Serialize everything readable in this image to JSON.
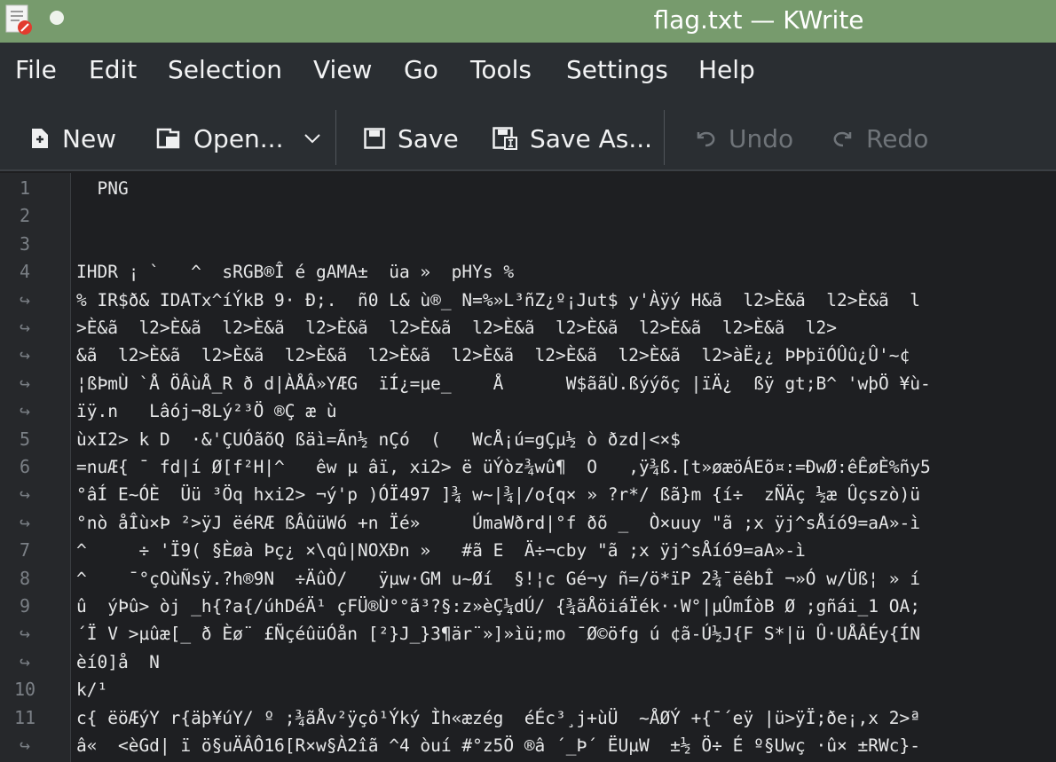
{
  "window": {
    "title": "flag.txt — KWrite"
  },
  "menubar": {
    "items": [
      "File",
      "Edit",
      "Selection",
      "View",
      "Go",
      "Tools",
      "Settings",
      "Help"
    ]
  },
  "toolbar": {
    "new_label": "New",
    "open_label": "Open...",
    "save_label": "Save",
    "save_as_label": "Save As...",
    "undo_label": "Undo",
    "redo_label": "Redo",
    "undo_enabled": false,
    "redo_enabled": false
  },
  "editor": {
    "gutter": [
      "1",
      "2",
      "3",
      "4",
      "↪",
      "↪",
      "↪",
      "↪",
      "↪",
      "5",
      "6",
      "↪",
      "↪",
      "7",
      "8",
      "9",
      "↪",
      "↪",
      "10",
      "11",
      "↪"
    ],
    "lines": [
      "  PNG",
      "",
      "",
      "IHDR ¡ `   ^  sRGB®Î é gAMA±  üa »  pHYs %",
      "% IR$ð& IDATx^íÝkB 9· Ð;.  ñ0 L& ù®_ N=%»L³ñZ¿º¡Jut$ y'Àÿý H&ã  l2>È&ã  l2>È&ã  l",
      ">È&ã  l2>È&ã  l2>È&ã  l2>È&ã  l2>È&ã  l2>È&ã  l2>È&ã  l2>È&ã  l2>È&ã  l2>",
      "&ã  l2>È&ã  l2>È&ã  l2>È&ã  l2>È&ã  l2>È&ã  l2>È&ã  l2>È&ã  l2>àË¿¿ ÞÞþïÓÛû¿Û'~¢",
      "¦ßÞmÙ `Å ÖÂùÅ_R ð d|ÀÅÂ»YÆG  ïÍ¿=µe_    Å      W$ããÙ.ßýýõç |ïÄ¿  ßÿ gt;B^ 'wþÖ ¥ù-",
      "ïÿ.n   Lâój¬8Lý²³Ö ®Ç æ ù",
      "ùxI2> k D  ·&'ÇUÓãõQ ßäì=Ãn½ nÇó  (   WcÅ¡ú=gÇµ½ ò ðzd|<×$",
      "=nuÆ{ ¯ fd|í Ø[f²H|^   êw µ âï, xi2> ë üÝòz¾wû¶  O   ,ÿ¾ß.[t»øæöÁEõ¤:=ÐwØ:êÊøÈ%ñy5",
      "°âÍ E~ÓÈ  Üü ³Öq hxi2> ¬ý'p )ÓÏ497 ]¾ w~|¾|/o{q× » ?r*/ ßã}m {í÷  zÑÄç ½æ Ûçszò)ü",
      "°nò åÎù×Þ ²>ÿJ ëéRÆ ßÂûüWó +n Ïé»     ÚmaWðrd|°f ðõ _  Ò×uuy \"ã ;x ÿj^sÅíó9=aA»-ì",
      "^     ÷ 'Ï9( §Èøà Þç¿ ×\\qû|NOXÐn »   #ã E  Ä÷¬cby \"ã ;x ÿj^sÅíó9=aA»-ì",
      "^    ¯°çOùÑsÿ.?h®9N  ÷ÄûÒ/   ÿµw·GM u~Øí  §!¦c Gé¬y ñ=/ö*ïP 2¾¯ëêbÎ ¬»Ó w/Üß¦ » í",
      "û  ýÞû> òj _h{?a{/úhDéÄ¹ çFÜ®Ù°°ã³?§:z»èÇ¼dÚ/ {¾ãÅöiáÏék··W°|µÛmÍòB Ø ;gñái_1 OA;",
      "´Ï V >µûæ[_ ð Èø¨ £ÑçéûüÓån [²}J_}3¶är¨»]»ìü;mo ¯Ø©öfg ú ¢ã-Ú½J{F S*|ü Û·UÅÂÉy{ÍN",
      "èí0]å  N",
      "k/¹",
      "c{ ëöÆýY r{äþ¥úY/ º ;¾ãÅv²ÿçô¹Ýký Ìh«æzég  éÉc³¸j+ùÜ  ~ÅØÝ +{¯´eÿ |ü>ÿÏ;ðe¡,x 2>ª",
      "â«  <èGd| ï ö§uÄÂÔ16[R×w§À2îã ^4 òuí #°z5Ö ®â ´_Þ´ ËUµW  ±½ Ö÷ É º§Uwç ·û× ±RWc}-"
    ]
  }
}
